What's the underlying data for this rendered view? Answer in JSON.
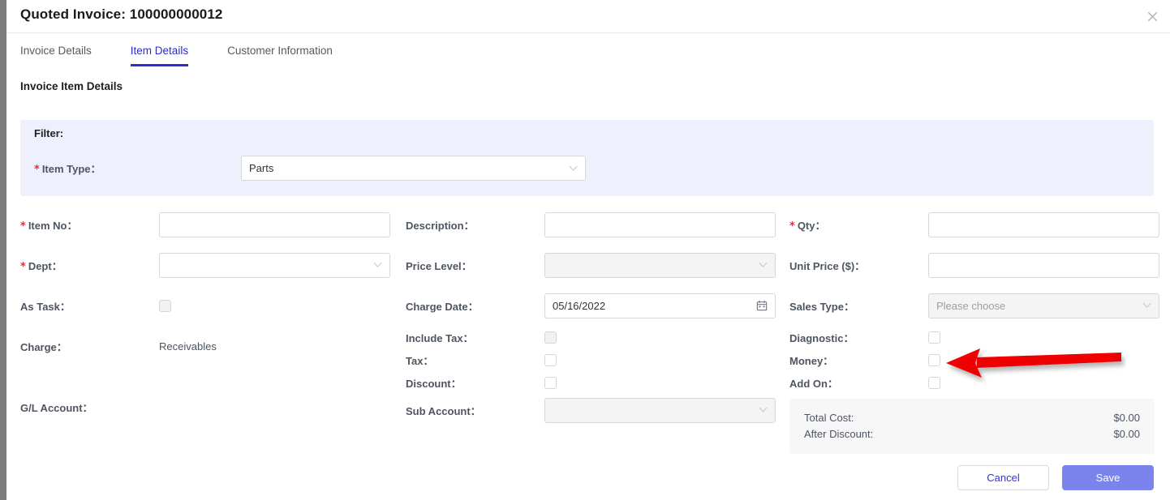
{
  "window": {
    "title": "Quoted Invoice: 100000000012",
    "close_label": "✕"
  },
  "tabs": [
    {
      "label": "Invoice Details",
      "active": false
    },
    {
      "label": "Item Details",
      "active": true
    },
    {
      "label": "Customer Information",
      "active": false
    }
  ],
  "section": {
    "heading": "Invoice Item Details"
  },
  "filter": {
    "legend": "Filter:",
    "item_type_label": "Item Type：",
    "item_type_value": "Parts"
  },
  "fields": {
    "item_no_label": "Item No：",
    "item_no_value": "",
    "dept_label": "Dept：",
    "dept_value": "",
    "as_task_label": "As Task：",
    "charge_label": "Charge：",
    "charge_value": "Receivables",
    "gl_account_label": "G/L Account：",
    "description_label": "Description：",
    "description_value": "",
    "price_level_label": "Price Level：",
    "price_level_value": "",
    "charge_date_label": "Charge Date：",
    "charge_date_value": "05/16/2022",
    "include_tax_label": "Include Tax：",
    "tax_label": "Tax：",
    "discount_label": "Discount：",
    "sub_account_label": "Sub Account：",
    "sub_account_value": "",
    "qty_label": "Qty：",
    "qty_value": "",
    "unit_price_label": "Unit Price ($)：",
    "unit_price_value": "",
    "sales_type_label": "Sales Type：",
    "sales_type_value": "Please choose",
    "diagnostic_label": "Diagnostic：",
    "money_label": "Money：",
    "add_on_label": "Add On："
  },
  "totals": {
    "total_cost_label": "Total Cost:",
    "total_cost_value": "$0.00",
    "after_discount_label": "After Discount:",
    "after_discount_value": "$0.00"
  },
  "footer": {
    "cancel_label": "Cancel",
    "save_label": "Save"
  },
  "colors": {
    "accent": "#2b2bd4",
    "filter_bg": "#eef0fd",
    "save_bg": "#7b83ed",
    "required_star": "#e8293c",
    "annotation_arrow": "#ee0000"
  },
  "required_marker": "*"
}
